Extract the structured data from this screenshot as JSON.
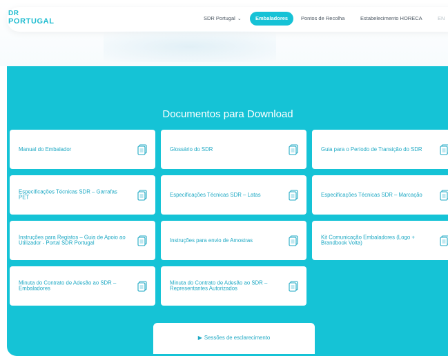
{
  "logo": {
    "line1": "DR",
    "line2": "PORTUGAL"
  },
  "nav": {
    "items": [
      {
        "label": "SDR Portugal",
        "has_dropdown": true
      },
      {
        "label": "Embaladores",
        "active": true
      },
      {
        "label": "Pontos de Recolha"
      },
      {
        "label": "Estabelecimento HORECA"
      }
    ],
    "language": "EN"
  },
  "section": {
    "title": "Documentos para Download",
    "documents": [
      {
        "label": "Manual do Embalador"
      },
      {
        "label": "Glossário do SDR"
      },
      {
        "label": "Guia para o Período de Transição do SDR"
      },
      {
        "label": "Especificações Técnicas SDR – Garrafas PET"
      },
      {
        "label": "Especificações Técnicas SDR – Latas"
      },
      {
        "label": "Especificações Técnicas SDR – Marcação"
      },
      {
        "label": "Instruções para Registos – Guia de Apoio ao Utilizador - Portal SDR Portugal"
      },
      {
        "label": "Instruções para envio de Amostras"
      },
      {
        "label": "Kit Comunicação Embaladores (Logo + Brandbook Volta)"
      },
      {
        "label": "Minuta do Contrato de Adesão ao SDR – Embaladores"
      },
      {
        "label": "Minuta do Contrato de Adesão ao SDR – Representantes Autorizados"
      }
    ],
    "sessions_button": "Sessões de esclarecimento"
  },
  "colors": {
    "accent": "#15c3d6",
    "card_text": "#1fa9c4",
    "white": "#ffffff"
  },
  "icons": {
    "document": "document-icon",
    "play": "play-icon",
    "dropdown": "chevron-down-icon"
  }
}
